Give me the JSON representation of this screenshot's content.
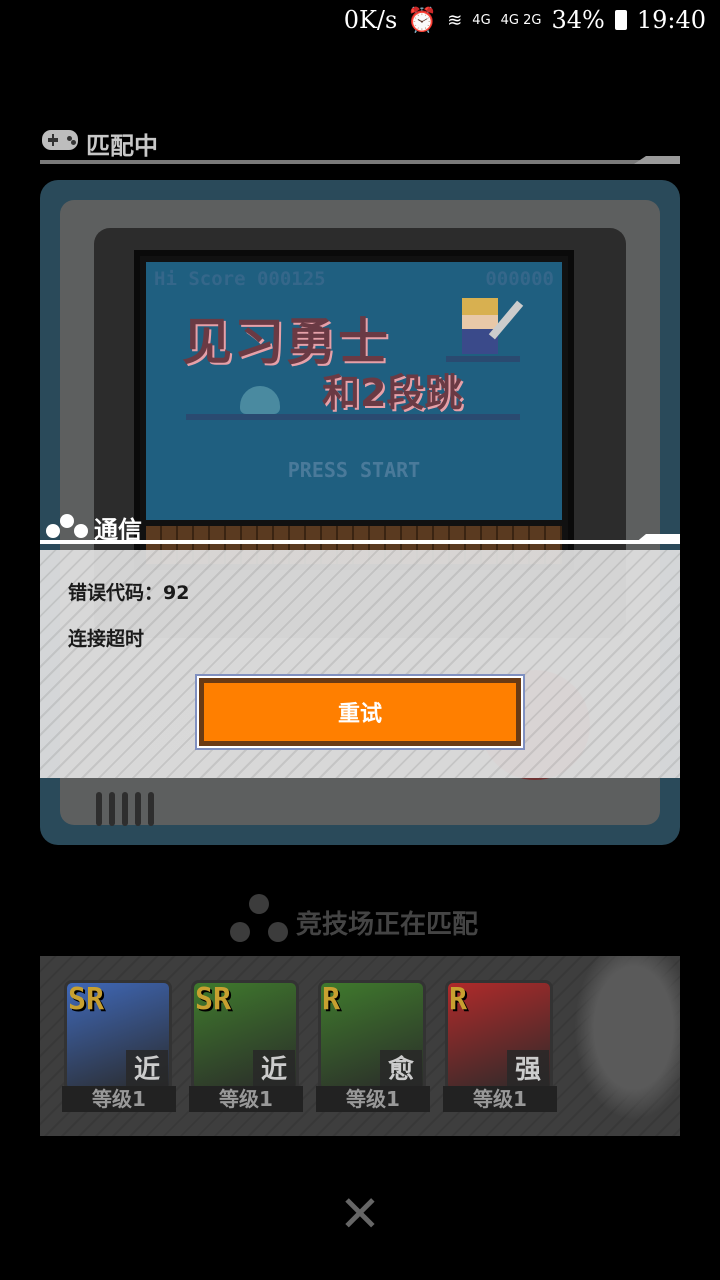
{
  "status_bar": {
    "speed": "0K/s",
    "net": "4G",
    "net2": "4G 2G",
    "battery": "34%",
    "time": "19:40"
  },
  "matching": {
    "title": "匹配中"
  },
  "game_screen": {
    "hi_score": "Hi Score 000125",
    "score": "000000",
    "press_start": "PRESS START"
  },
  "comm": {
    "title": "通信",
    "error_code": "错误代码：92",
    "error_message": "连接超时",
    "retry_label": "重试"
  },
  "arena": {
    "title": "竞技场正在匹配"
  },
  "cards": [
    {
      "rarity": "SR",
      "type": "近",
      "level": "等级1",
      "color": "#3f68b8"
    },
    {
      "rarity": "SR",
      "type": "近",
      "level": "等级1",
      "color": "#3f7a2c"
    },
    {
      "rarity": "R",
      "type": "愈",
      "level": "等级1",
      "color": "#3f7a2c"
    },
    {
      "rarity": "R",
      "type": "强",
      "level": "等级1",
      "color": "#b02a2a"
    }
  ],
  "close": {
    "icon": "close-icon"
  }
}
